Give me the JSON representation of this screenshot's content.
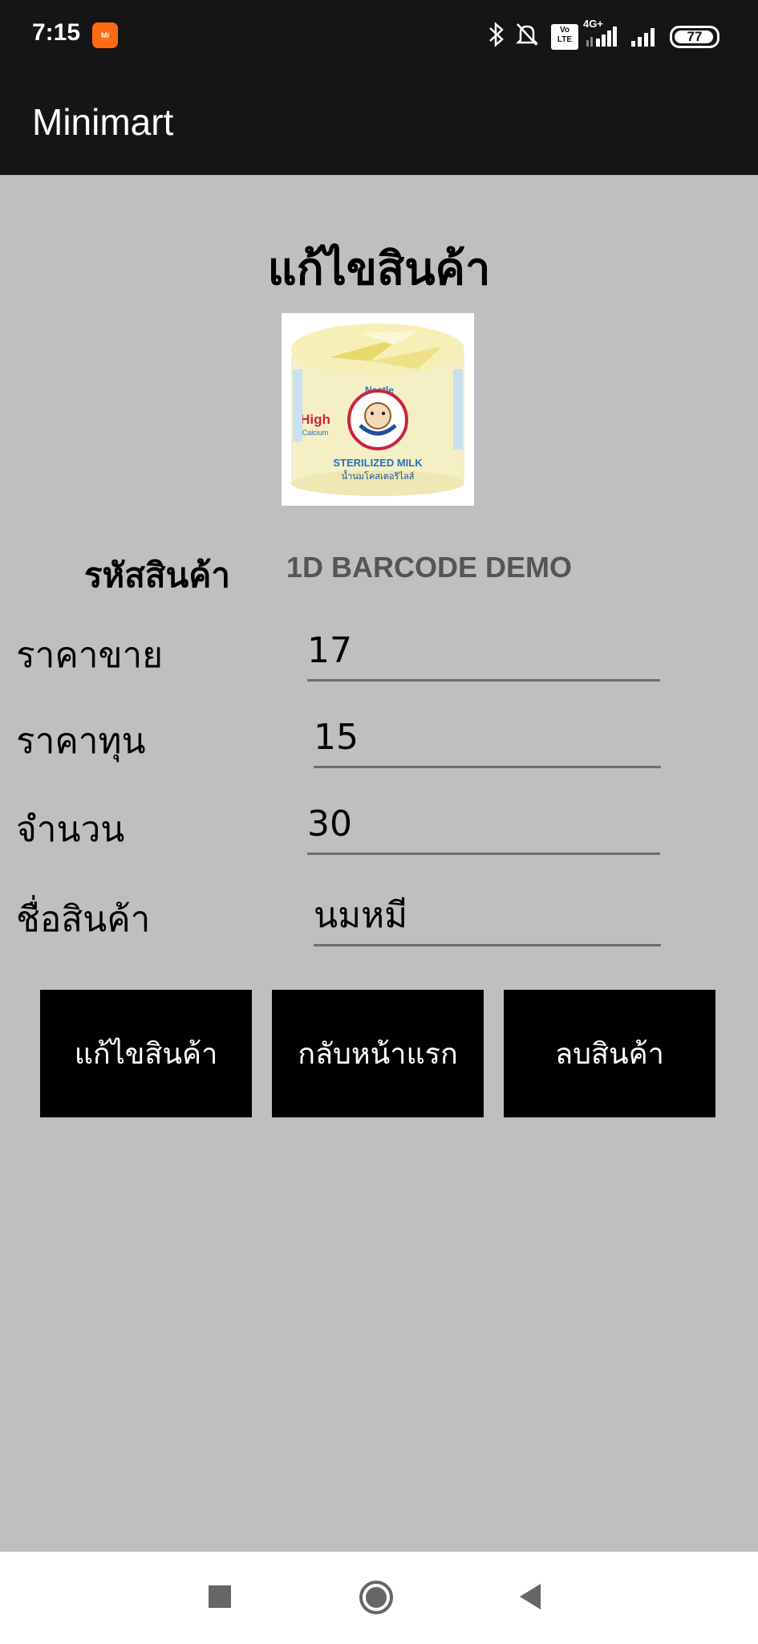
{
  "status_bar": {
    "time": "7:15",
    "app_badge": "Mi",
    "network_label": "4G+",
    "volte_label": "Vo LTE",
    "battery_level": "77"
  },
  "app_bar": {
    "title": "Minimart"
  },
  "page": {
    "title": "แก้ไขสินค้า",
    "product_code_label": "รหัสสินค้า",
    "product_code_value": "1D BARCODE DEMO",
    "product_image": {
      "brand": "Nestle",
      "tag_line1": "High",
      "tag_line2": "Calcium",
      "product_en": "STERILIZED MILK",
      "product_th": "น้ำนมโคสเตอริไลส์"
    },
    "fields": [
      {
        "label": "ราคาขาย",
        "value": "17"
      },
      {
        "label": "ราคาทุน",
        "value": "15"
      },
      {
        "label": "จำนวน",
        "value": "30"
      },
      {
        "label": "ชื่อสินค้า",
        "value": "นมหมี"
      }
    ],
    "buttons": {
      "edit": "แก้ไขสินค้า",
      "home": "กลับหน้าแรก",
      "delete": "ลบสินค้า"
    }
  },
  "nav_icons": [
    "recents-icon",
    "home-icon",
    "back-icon"
  ]
}
